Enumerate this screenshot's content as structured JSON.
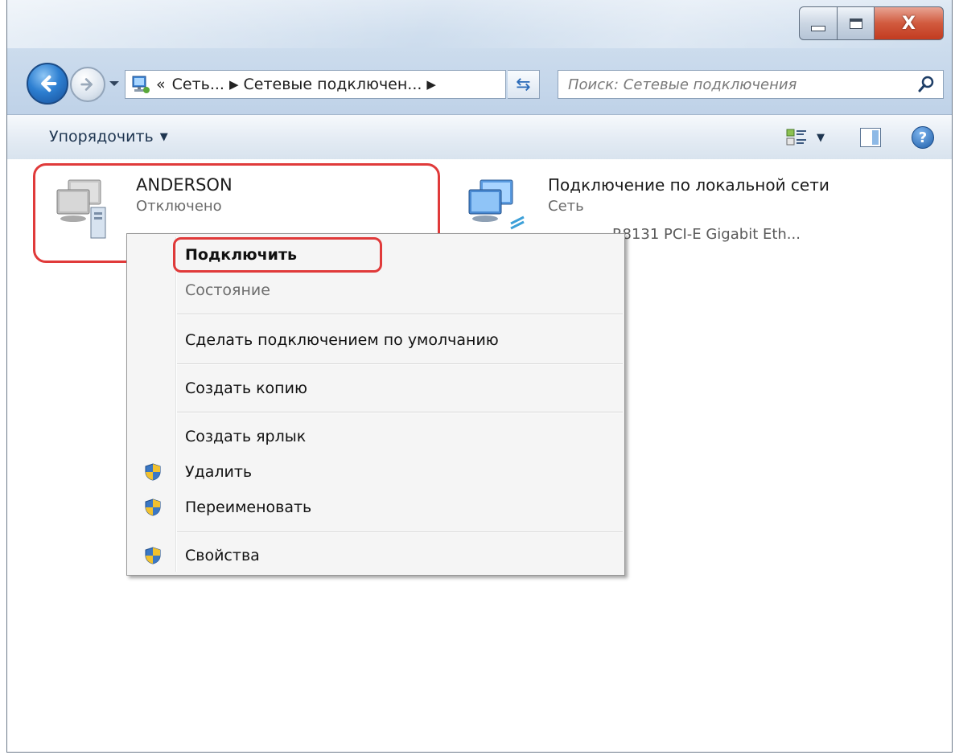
{
  "window": {
    "caption": {
      "close_glyph": "X"
    }
  },
  "nav": {
    "address_prefix": "«",
    "breadcrumb": [
      "Сеть...",
      "Сетевые подключен..."
    ],
    "search_placeholder": "Поиск: Сетевые подключения"
  },
  "toolbar": {
    "organize_label": "Упорядочить",
    "help_glyph": "?"
  },
  "connections": [
    {
      "name": "ANDERSON",
      "status": "Отключено",
      "highlighted": true
    },
    {
      "name": "Подключение по локальной сети",
      "status": "Сеть",
      "adapter": "R8131 PCI-E Gigabit Eth..."
    }
  ],
  "context_menu": {
    "items": [
      {
        "label": "Подключить",
        "bold": true,
        "highlighted": true
      },
      {
        "label": "Состояние",
        "disabled": true
      },
      {
        "label": "Сделать подключением по умолчанию"
      },
      {
        "label": "Создать копию"
      },
      {
        "label": "Создать ярлык"
      },
      {
        "label": "Удалить",
        "icon": "uac-shield-icon"
      },
      {
        "label": "Переименовать",
        "icon": "uac-shield-icon"
      },
      {
        "label": "Свойства",
        "icon": "uac-shield-icon"
      }
    ]
  },
  "colors": {
    "highlight": "#e03a3a",
    "accent": "#2d7fd1"
  }
}
